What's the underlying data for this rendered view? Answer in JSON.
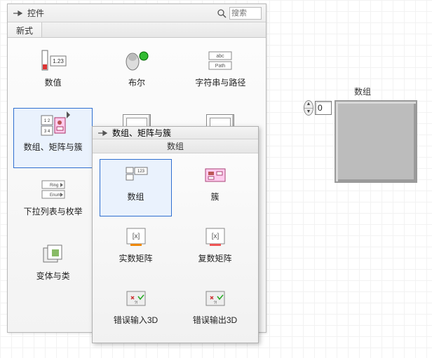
{
  "palette": {
    "title": "控件",
    "search_placeholder": "搜索",
    "tab_label": "新式",
    "items": [
      {
        "label": "数值",
        "icon": "numeric"
      },
      {
        "label": "布尔",
        "icon": "boolean"
      },
      {
        "label": "字符串与路径",
        "icon": "string-path"
      },
      {
        "label": "数组、矩阵与簇",
        "icon": "array-cluster",
        "selected": true,
        "has_sub": true
      },
      {
        "label": "",
        "icon": "generic1"
      },
      {
        "label": "",
        "icon": "generic2"
      },
      {
        "label": "下拉列表与枚举",
        "icon": "enum"
      },
      {
        "label": "",
        "icon": "blank"
      },
      {
        "label": "",
        "icon": "blank"
      },
      {
        "label": "变体与类",
        "icon": "variant"
      }
    ]
  },
  "subpalette": {
    "title": "数组、矩阵与簇",
    "subtitle": "数组",
    "items": [
      {
        "label": "数组",
        "icon": "array",
        "selected": true
      },
      {
        "label": "簇",
        "icon": "cluster"
      },
      {
        "label": "实数矩阵",
        "icon": "real-matrix"
      },
      {
        "label": "复数矩阵",
        "icon": "complex-matrix"
      },
      {
        "label": "错误输入3D",
        "icon": "error-in"
      },
      {
        "label": "错误输出3D",
        "icon": "error-out"
      }
    ]
  },
  "array_control": {
    "title": "数组",
    "index_value": "0"
  }
}
